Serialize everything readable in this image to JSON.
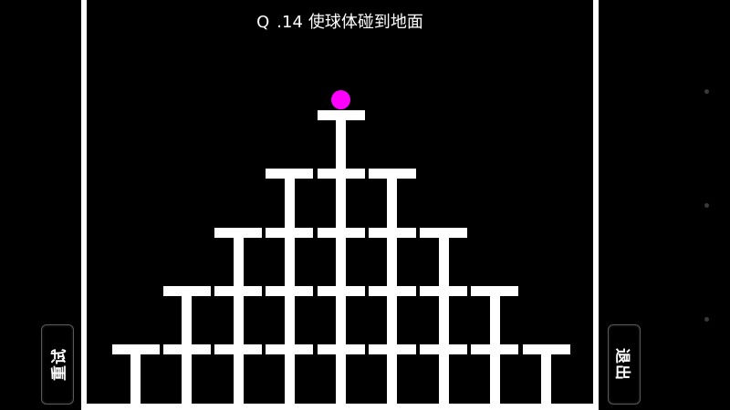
{
  "level": {
    "prefix_icon": "q-magnifier-glyph",
    "prefix_glyph": "Q",
    "number": ".14",
    "instruction": "使球体碰到地面"
  },
  "buttons": {
    "restart_label": "重试",
    "exit_label": "退出"
  },
  "colors": {
    "background": "#000000",
    "structure": "#ffffff",
    "ball": "#ff00ff"
  },
  "pyramid": {
    "rows": [
      1,
      3,
      5,
      7,
      9
    ]
  }
}
